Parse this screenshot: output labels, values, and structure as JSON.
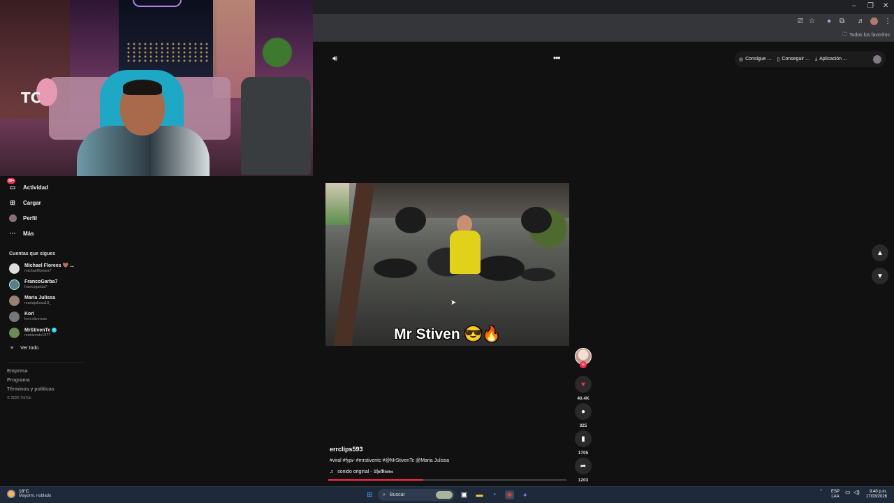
{
  "browser": {
    "bookmarks_all": "Todos los favoritos",
    "window_controls": [
      "–",
      "❐",
      "✕"
    ]
  },
  "sidebar": {
    "nav": [
      {
        "label": "Actividad",
        "icon": "inbox-icon",
        "badge": "99+"
      },
      {
        "label": "Cargar",
        "icon": "upload-icon"
      },
      {
        "label": "Perfil",
        "icon": "profile-avatar-icon"
      },
      {
        "label": "Más",
        "icon": "more-icon"
      }
    ],
    "following_title": "Cuentas que sigues",
    "following": [
      {
        "name": "Michael Florees 🤎 ...",
        "username": "michaelflorees7"
      },
      {
        "name": "FrancoGarba7",
        "username": "francogarba7"
      },
      {
        "name": "Maria Julissa",
        "username": "mariajulissa13_"
      },
      {
        "name": "Kori",
        "username": "kori.oliveross"
      },
      {
        "name": "MrStivenTc",
        "username": "mrstiventc1977",
        "verified": true
      }
    ],
    "see_all": "Ver todo",
    "footer": [
      "Empresa",
      "Programa",
      "Términos y políticas"
    ],
    "copyright": "© 2026 TikTok"
  },
  "top_pills": [
    {
      "label": "Consigue ...",
      "icon": "coin-icon"
    },
    {
      "label": "Conseguir ...",
      "icon": "phone-icon"
    },
    {
      "label": "Aplicación ...",
      "icon": "download-icon"
    }
  ],
  "video": {
    "caption": "Mr Stiven 😎🔥",
    "author": "errclips593",
    "description": "#viral #fyp⩗ #mrstiventc #@MrStivenTc @Maria Julissa",
    "sound": "sonido original - 𝕿𝖍𝖊𝕭𝖗𝖆𝖓𝖘",
    "progress": 0.4,
    "likes": "40.4K",
    "comments": "325",
    "saves": "1705",
    "shares": "1203"
  },
  "taskbar": {
    "temp": "18°C",
    "weather": "Mayorm. nublado",
    "search_placeholder": "Buscar",
    "lang": "ESP",
    "lang2": "LAA",
    "time": "9:40 p.m.",
    "date": "17/03/2026"
  },
  "colors": {
    "accent": "#fe2c55",
    "verified": "#20d5ec",
    "taskbar": "#1e2a3a"
  }
}
